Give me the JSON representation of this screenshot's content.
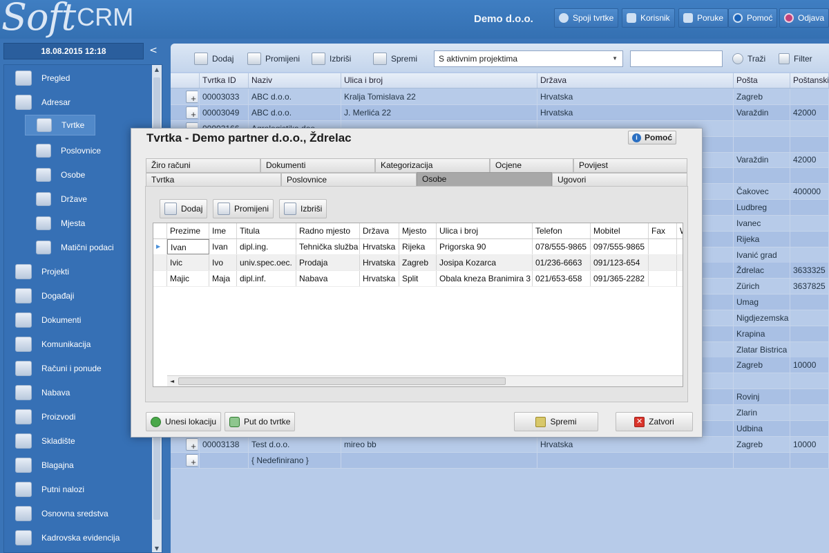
{
  "header": {
    "logo_soft": "Soft",
    "logo_crm": "CRM",
    "company": "Demo d.o.o.",
    "buttons": [
      {
        "label": "Spoji tvrtke",
        "icon": "merge-icon"
      },
      {
        "label": "Korisnik",
        "icon": "user-icon"
      },
      {
        "label": "Poruke",
        "icon": "mail-icon"
      },
      {
        "label": "Pomoć",
        "icon": "info-icon"
      },
      {
        "label": "Odjava",
        "icon": "power-icon"
      }
    ]
  },
  "sidebar": {
    "datetime": "18.08.2015 12:18",
    "collapse": "<",
    "items": [
      {
        "label": "Pregled"
      },
      {
        "label": "Adresar"
      },
      {
        "label": "Tvrtke"
      },
      {
        "label": "Poslovnice"
      },
      {
        "label": "Osobe"
      },
      {
        "label": "Države"
      },
      {
        "label": "Mjesta"
      },
      {
        "label": "Matični podaci"
      },
      {
        "label": "Projekti"
      },
      {
        "label": "Događaji"
      },
      {
        "label": "Dokumenti"
      },
      {
        "label": "Komunikacija"
      },
      {
        "label": "Računi i ponude"
      },
      {
        "label": "Nabava"
      },
      {
        "label": "Proizvodi"
      },
      {
        "label": "Skladište"
      },
      {
        "label": "Blagajna"
      },
      {
        "label": "Putni nalozi"
      },
      {
        "label": "Osnovna sredstva"
      },
      {
        "label": "Kadrovska evidencija"
      }
    ]
  },
  "toolbar": {
    "add": "Dodaj",
    "edit": "Promijeni",
    "delete": "Izbriši",
    "save": "Spremi",
    "filter_select": "S aktivnim projektima",
    "search_value": "",
    "search": "Traži",
    "filter": "Filter"
  },
  "grid": {
    "columns": [
      "Tvrtka ID",
      "Naziv",
      "Ulica i broj",
      "Država",
      "Pošta",
      "Poštanski"
    ],
    "rows": [
      [
        "00003033",
        "ABC d.o.o.",
        "Kralja Tomislava 22",
        "Hrvatska",
        "Zagreb",
        ""
      ],
      [
        "00003049",
        "ABC d.o.o.",
        "J. Merlića 22",
        "Hrvatska",
        "Varaždin",
        "42000"
      ],
      [
        "00003166",
        "Agrologistika doo",
        "",
        "",
        "",
        ""
      ],
      [
        "",
        "",
        "",
        "",
        "",
        ""
      ],
      [
        "",
        "",
        "",
        "",
        "Varaždin",
        "42000"
      ],
      [
        "",
        "",
        "",
        "",
        "",
        ""
      ],
      [
        "",
        "",
        "",
        "",
        "Čakovec",
        "400000"
      ],
      [
        "",
        "",
        "",
        "",
        "Ludbreg",
        ""
      ],
      [
        "",
        "",
        "",
        "",
        "Ivanec",
        ""
      ],
      [
        "",
        "",
        "",
        "",
        "Rijeka",
        ""
      ],
      [
        "",
        "",
        "",
        "",
        "Ivanić grad",
        ""
      ],
      [
        "",
        "",
        "",
        "",
        "Ždrelac",
        "3633325"
      ],
      [
        "",
        "",
        "",
        "",
        "Zürich",
        "3637825"
      ],
      [
        "",
        "",
        "",
        "",
        "Umag",
        ""
      ],
      [
        "",
        "",
        "",
        "",
        "Nigdjezemska",
        ""
      ],
      [
        "",
        "",
        "",
        "",
        "Krapina",
        ""
      ],
      [
        "",
        "",
        "",
        "",
        "Zlatar Bistrica",
        ""
      ],
      [
        "",
        "",
        "",
        "",
        "Zagreb",
        "10000"
      ],
      [
        "",
        "",
        "",
        "",
        "",
        ""
      ],
      [
        "",
        "",
        "",
        "",
        "Rovinj",
        ""
      ],
      [
        "",
        "",
        "",
        "",
        "Zlarin",
        ""
      ],
      [
        "",
        "",
        "",
        "",
        "Udbina",
        ""
      ],
      [
        "00003138",
        "Test d.o.o.",
        "mireo bb",
        "Hrvatska",
        "Zagreb",
        "10000"
      ],
      [
        "",
        "{ Nedefinirano }",
        "",
        "",
        "",
        ""
      ]
    ]
  },
  "dialog": {
    "title": "Tvrtka - Demo partner d.o.o., Ždrelac",
    "help": "Pomoć",
    "tabs_row1": [
      "Žiro računi",
      "Dokumenti",
      "Kategorizacija",
      "Ocjene",
      "Povijest"
    ],
    "tabs_row2": [
      "Tvrtka",
      "Poslovnice",
      "Osobe",
      "Ugovori"
    ],
    "panel_buttons": {
      "add": "Dodaj",
      "edit": "Promijeni",
      "delete": "Izbriši"
    },
    "table": {
      "columns": [
        "Prezime",
        "Ime",
        "Titula",
        "Radno mjesto",
        "Država",
        "Mjesto",
        "Ulica i broj",
        "Telefon",
        "Mobitel",
        "Fax",
        "W"
      ],
      "rows": [
        [
          "Ivan",
          "Ivan",
          "dipl.ing.",
          "Tehnička služba",
          "Hrvatska",
          "Rijeka",
          "Prigorska 90",
          "078/555-9865",
          "097/555-9865",
          "",
          ""
        ],
        [
          "Ivic",
          "Ivo",
          "univ.spec.oec.",
          "Prodaja",
          "Hrvatska",
          "Zagreb",
          "Josipa Kozarca",
          "01/236-6663",
          "091/123-654",
          "",
          ""
        ],
        [
          "Majic",
          "Maja",
          "dipl.inf.",
          "Nabava",
          "Hrvatska",
          "Split",
          "Obala kneza Branimira 3",
          "021/653-658",
          "091/365-2282",
          "",
          ""
        ]
      ]
    },
    "bottom": {
      "location": "Unesi lokaciju",
      "route": "Put do tvrtke",
      "save": "Spremi",
      "close": "Zatvori"
    }
  }
}
